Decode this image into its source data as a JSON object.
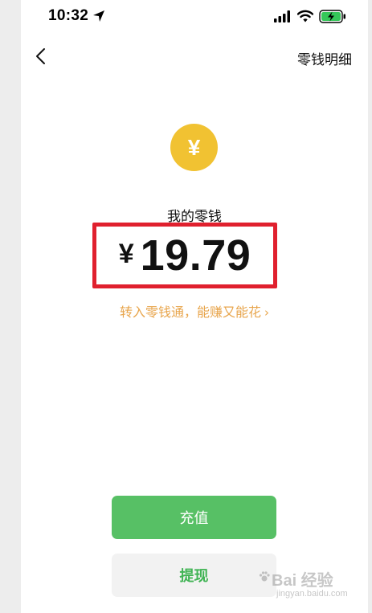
{
  "status_bar": {
    "time": "10:32"
  },
  "nav": {
    "detail_link": "零钱明细"
  },
  "balance": {
    "coin_symbol": "¥",
    "label": "我的零钱",
    "currency": "¥",
    "amount": "19.79"
  },
  "promo": {
    "text": "转入零钱通，能赚又能花",
    "chevron": "›"
  },
  "buttons": {
    "recharge": "充值",
    "withdraw": "提现"
  },
  "watermark": {
    "text": "Bai 经验",
    "url": "jingyan.baidu.com"
  },
  "colors": {
    "coin": "#f1c232",
    "highlight": "#e0202e",
    "promo": "#e8a54c",
    "primary_green": "#57c065",
    "withdraw_text": "#41b455"
  },
  "icons": {
    "back": "chevron-left-icon",
    "location": "location-arrow-icon",
    "signal": "cellular-signal-icon",
    "wifi": "wifi-icon",
    "battery": "battery-charging-icon"
  }
}
